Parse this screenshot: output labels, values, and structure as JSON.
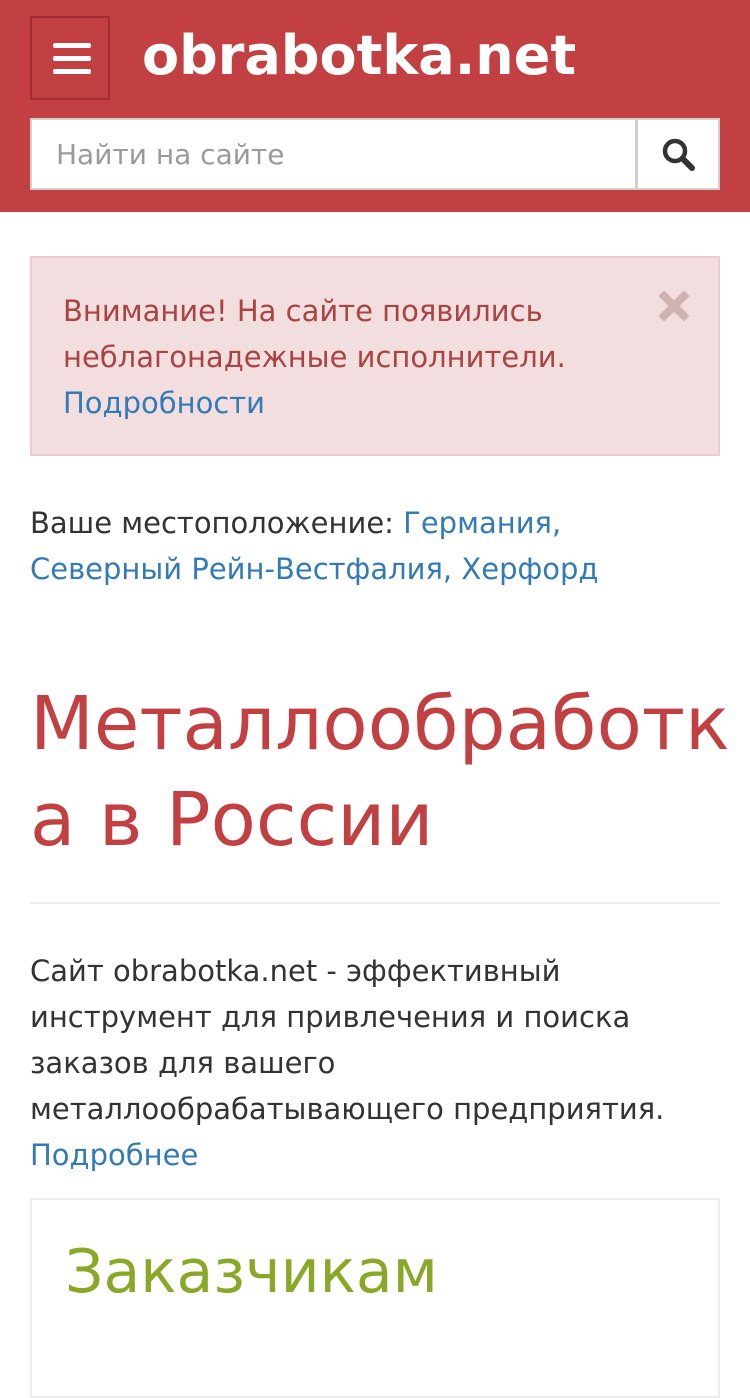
{
  "header": {
    "logo": "obrabotka.net",
    "menu_icon": "hamburger-menu-icon",
    "search": {
      "placeholder": "Найти на сайте",
      "value": "",
      "button_icon": "search-icon"
    },
    "background_color": "#c34042"
  },
  "alert": {
    "message": "Внимание! На сайте появились неблагонадежные исполнители.",
    "link_label": "Подробности",
    "close_icon": "close-icon"
  },
  "location": {
    "label": "Ваше местоположение: ",
    "value": "Германия, Северный Рейн-Вестфалия, Херфорд"
  },
  "main": {
    "title": "Металлообработка в России",
    "intro_text": "Сайт obrabotka.net - эффективный инструмент для привлечения и поиска заказов для вашего металлообрабатывающего предприятия.",
    "intro_link": "Подробнее"
  },
  "card": {
    "title": "Заказчикам"
  },
  "colors": {
    "brand_red": "#c34042",
    "link_blue": "#337ab7",
    "alert_text": "#a94442",
    "alert_bg": "#f2dede",
    "card_title_green": "#8aa828"
  }
}
